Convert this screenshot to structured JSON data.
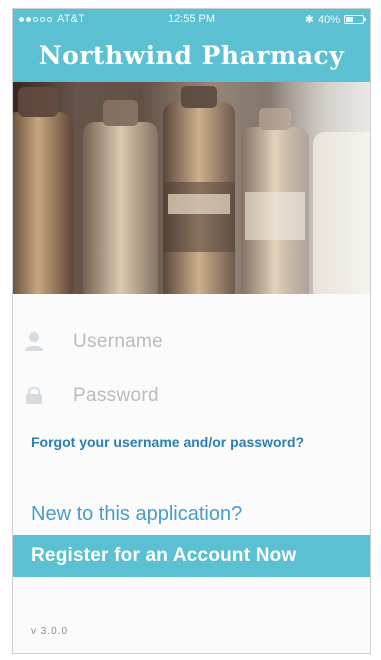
{
  "status_bar": {
    "carrier": "AT&T",
    "time": "12:55 PM",
    "bluetooth": "✱",
    "battery": "40%"
  },
  "header": {
    "title": "Northwind Pharmacy"
  },
  "login": {
    "username_placeholder": "Username",
    "password_placeholder": "Password",
    "forgot_link": "Forgot your username and/or password?"
  },
  "signup": {
    "prompt": "New to this application?",
    "register_label": "Register for an Account Now"
  },
  "footer": {
    "version": "v 3.0.0"
  },
  "colors": {
    "header_bg": "#5bc0d2",
    "link": "#2b7fb0",
    "placeholder": "#b9bcbf"
  },
  "icons": {
    "username": "user-icon",
    "password": "lock-icon"
  }
}
